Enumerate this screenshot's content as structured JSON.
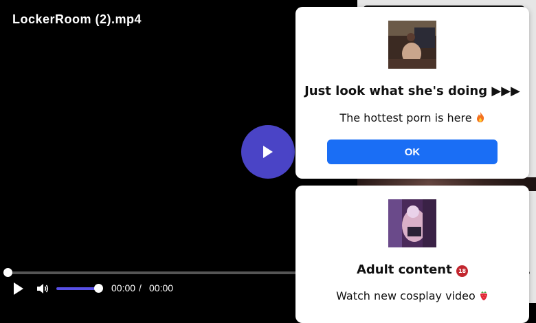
{
  "player": {
    "title": "LockerRoom (2).mp4",
    "current_time": "00:00",
    "separator": "/",
    "duration": "00:00",
    "progress_fraction": 0,
    "volume_fraction": 1
  },
  "popups": [
    {
      "title": "Just look what she's doing ▶▶▶",
      "text": "The hottest porn is here",
      "button_label": "OK",
      "button_color": "#1a6ef5"
    },
    {
      "title": "Adult content",
      "text": "Watch new cosplay video"
    }
  ],
  "colors": {
    "play_button": "#4a44c6",
    "volume_bar": "#5850e6"
  },
  "icons": [
    "play-icon",
    "volume-icon",
    "fire-icon",
    "adult-18-icon",
    "strawberry-icon"
  ]
}
